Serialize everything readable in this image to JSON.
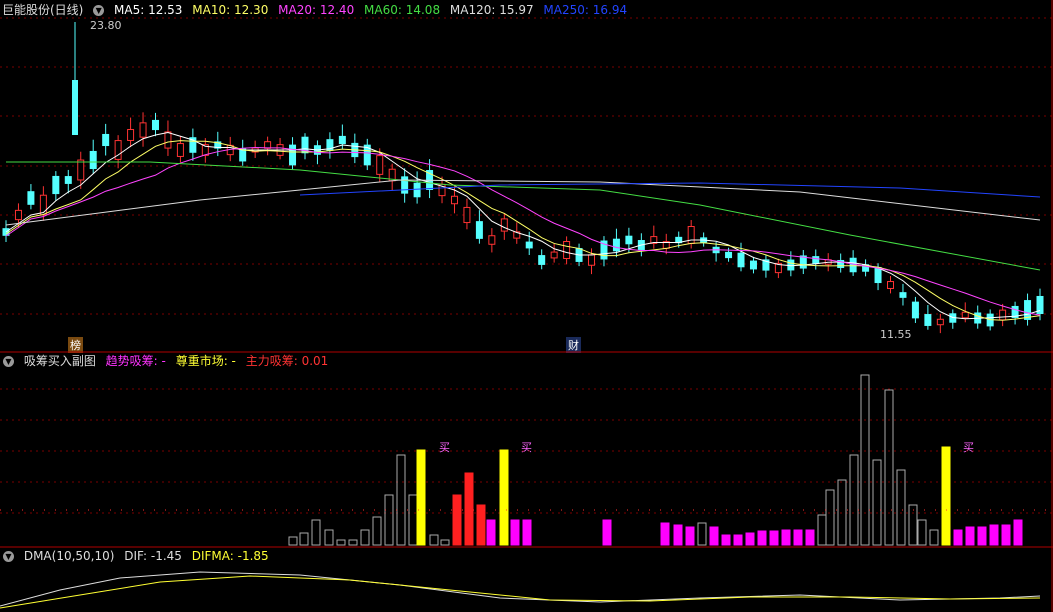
{
  "main": {
    "title": "巨能股份(日线)",
    "ma": [
      {
        "label": "MA5: 12.53",
        "color": "#ffffff"
      },
      {
        "label": "MA10: 12.30",
        "color": "#ffff66"
      },
      {
        "label": "MA20: 12.40",
        "color": "#ff44ff"
      },
      {
        "label": "MA60: 14.08",
        "color": "#44dd44"
      },
      {
        "label": "MA120: 15.97",
        "color": "#dddddd"
      },
      {
        "label": "MA250: 16.94",
        "color": "#2244ff"
      }
    ],
    "high_label": "23.80",
    "low_label": "11.55",
    "badge_bang": "榜",
    "badge_cai": "财"
  },
  "sub1": {
    "title": "吸筹买入副图",
    "items": [
      {
        "label": "趋势吸筹: -",
        "color": "#ff33ff"
      },
      {
        "label": "尊重市场: -",
        "color": "#ffff33"
      },
      {
        "label": "主力吸筹: 0.01",
        "color": "#ff3333"
      }
    ],
    "buy_label": "买"
  },
  "sub2": {
    "title": "DMA(10,50,10)",
    "items": [
      {
        "label": "DIF: -1.45",
        "color": "#dddddd"
      },
      {
        "label": "DIFMA: -1.85",
        "color": "#ffff33"
      }
    ]
  },
  "colors": {
    "up": "#ff3333",
    "down": "#55ffff",
    "grid": "#7a0000",
    "border": "#b00000"
  }
}
